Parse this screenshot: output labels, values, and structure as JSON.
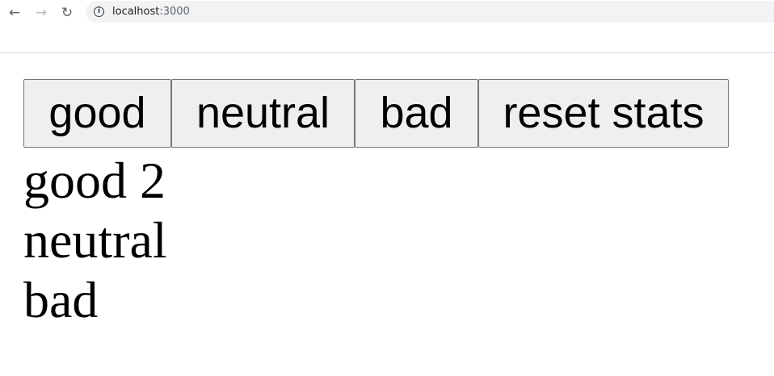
{
  "browser": {
    "url_host": "localhost",
    "url_port": ":3000",
    "back_icon": "arrow-left-icon",
    "forward_icon": "arrow-right-icon",
    "reload_icon": "reload-icon",
    "info_icon": "info-icon"
  },
  "buttons": {
    "good": "good",
    "neutral": "neutral",
    "bad": "bad",
    "reset": "reset stats"
  },
  "stats": [
    {
      "label": "good",
      "value": "2"
    },
    {
      "label": "neutral",
      "value": ""
    },
    {
      "label": "bad",
      "value": ""
    }
  ]
}
